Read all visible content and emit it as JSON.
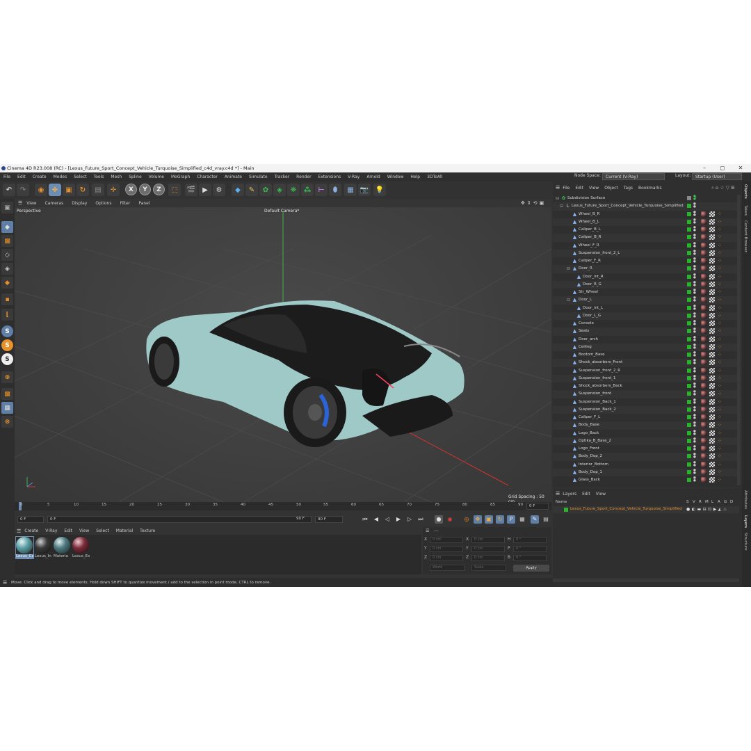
{
  "window": {
    "title": "Cinema 4D R23.008 (RC) - [Lexus_Future_Sport_Concept_Vehicle_Turquoise_Simplified_c4d_vray.c4d *] - Main",
    "minimize": "–",
    "maximize": "◻",
    "close": "✕"
  },
  "menubar": {
    "items": [
      "File",
      "Edit",
      "Create",
      "Modes",
      "Select",
      "Tools",
      "Mesh",
      "Spline",
      "Volume",
      "MoGraph",
      "Character",
      "Animate",
      "Simulate",
      "Tracker",
      "Render",
      "Extensions",
      "V-Ray",
      "Arnold",
      "Window",
      "Help",
      "3DToAll"
    ],
    "node_space_label": "Node Space:",
    "node_space_value": "Current (V-Ray)",
    "layout_label": "Layout:",
    "layout_value": "Startup (User)"
  },
  "toolbar": {
    "axis_x": "X",
    "axis_y": "Y",
    "axis_z": "Z"
  },
  "viewport": {
    "menu": [
      "View",
      "Cameras",
      "Display",
      "Options",
      "Filter",
      "Panel"
    ],
    "view_name": "Perspective",
    "camera": "Default Camera*",
    "grid_spacing": "Grid Spacing : 50 cm"
  },
  "timeline": {
    "ticks": [
      "0",
      "5",
      "10",
      "15",
      "20",
      "25",
      "30",
      "35",
      "40",
      "45",
      "50",
      "55",
      "60",
      "65",
      "70",
      "75",
      "80",
      "85",
      "90"
    ],
    "current_frame": "0 F",
    "start": "0 F",
    "min": "0 F",
    "max": "90 F",
    "end": "90 F"
  },
  "material_manager": {
    "menu": [
      "Create",
      "V-Ray",
      "Edit",
      "View",
      "Select",
      "Material",
      "Texture"
    ],
    "materials": [
      {
        "name": "Lexus_Ca",
        "color": "#5b9fa6"
      },
      {
        "name": "Lexus_In",
        "color": "#3a3a3a"
      },
      {
        "name": "Materia",
        "color": "#4e7a80"
      },
      {
        "name": "Lexus_Ex",
        "color": "#7a2c3a"
      }
    ]
  },
  "coordinates": {
    "header": "---",
    "rows": [
      {
        "a": "X",
        "av": "0 cm",
        "b": "X",
        "bv": "0 cm",
        "c": "H",
        "cv": "0 °"
      },
      {
        "a": "Y",
        "av": "0 cm",
        "b": "Y",
        "bv": "0 cm",
        "c": "P",
        "cv": "0 °"
      },
      {
        "a": "Z",
        "av": "0 cm",
        "b": "Z",
        "bv": "0 cm",
        "c": "B",
        "cv": "0 °"
      }
    ],
    "mode1": "World",
    "mode2": "Scale",
    "apply": "Apply"
  },
  "status": {
    "text": "Move: Click and drag to move elements. Hold down SHIFT to quantize movement / add to the selection in point mode, CTRL to remove."
  },
  "objects_panel": {
    "menu": [
      "File",
      "Edit",
      "View",
      "Object",
      "Tags",
      "Bookmarks"
    ],
    "items": [
      {
        "name": "Subdivision Surface",
        "indent": 0
      },
      {
        "name": "Lexus_Future_Sport_Concept_Vehicle_Turquoise_Simplified",
        "indent": 1
      },
      {
        "name": "Wheel_B_R",
        "indent": 2
      },
      {
        "name": "Wheel_B_L",
        "indent": 2
      },
      {
        "name": "Caliper_B_L",
        "indent": 2
      },
      {
        "name": "Caliper_B_R",
        "indent": 2
      },
      {
        "name": "Wheel_F_R",
        "indent": 2
      },
      {
        "name": "Suspension_front_2_L",
        "indent": 2
      },
      {
        "name": "Caliper_F_R",
        "indent": 2
      },
      {
        "name": "Door_R",
        "indent": 2
      },
      {
        "name": "Door_int_R",
        "indent": 3
      },
      {
        "name": "Door_R_G",
        "indent": 3
      },
      {
        "name": "Str_Wheel",
        "indent": 2
      },
      {
        "name": "Door_L",
        "indent": 2
      },
      {
        "name": "Door_int_L",
        "indent": 3
      },
      {
        "name": "Door_L_G",
        "indent": 3
      },
      {
        "name": "Console",
        "indent": 2
      },
      {
        "name": "Seats",
        "indent": 2
      },
      {
        "name": "Door_arch",
        "indent": 2
      },
      {
        "name": "Ceiling",
        "indent": 2
      },
      {
        "name": "Bootom_Base",
        "indent": 2
      },
      {
        "name": "Shock_absorbers_Front",
        "indent": 2
      },
      {
        "name": "Suspension_front_2_R",
        "indent": 2
      },
      {
        "name": "Suspension_front_1",
        "indent": 2
      },
      {
        "name": "Shock_absorbers_Back",
        "indent": 2
      },
      {
        "name": "Suspension_front",
        "indent": 2
      },
      {
        "name": "Suspension_Back_1",
        "indent": 2
      },
      {
        "name": "Suspension_Back_2",
        "indent": 2
      },
      {
        "name": "Caliper_F_L",
        "indent": 2
      },
      {
        "name": "Body_Base",
        "indent": 2
      },
      {
        "name": "Logo_Back",
        "indent": 2
      },
      {
        "name": "Optika_B_Base_2",
        "indent": 2
      },
      {
        "name": "Logo_Front",
        "indent": 2
      },
      {
        "name": "Body_Dop_2",
        "indent": 2
      },
      {
        "name": "Interior_Bottom",
        "indent": 2
      },
      {
        "name": "Body_Dop_1",
        "indent": 2
      },
      {
        "name": "Glass_Back",
        "indent": 2
      }
    ]
  },
  "side_tabs": [
    "Objects",
    "Takes",
    "Content Browser",
    "Attributes",
    "Layers",
    "Structure"
  ],
  "layers_panel": {
    "menu": [
      "Layers",
      "Edit",
      "View"
    ],
    "col_name": "Name",
    "cols": [
      "S",
      "V",
      "R",
      "M",
      "L",
      "A",
      "G",
      "D"
    ],
    "layer_name": "Lexus_Future_Sport_Concept_Vehicle_Turquoise_Simplified",
    "layer_color": "#2db32d"
  },
  "colors": {
    "accent_orange": "#e8902a",
    "select_blue": "#6d8db3",
    "car_body": "#9ec9c6",
    "axis_green": "#3ab54a",
    "axis_red": "#d2332e"
  }
}
